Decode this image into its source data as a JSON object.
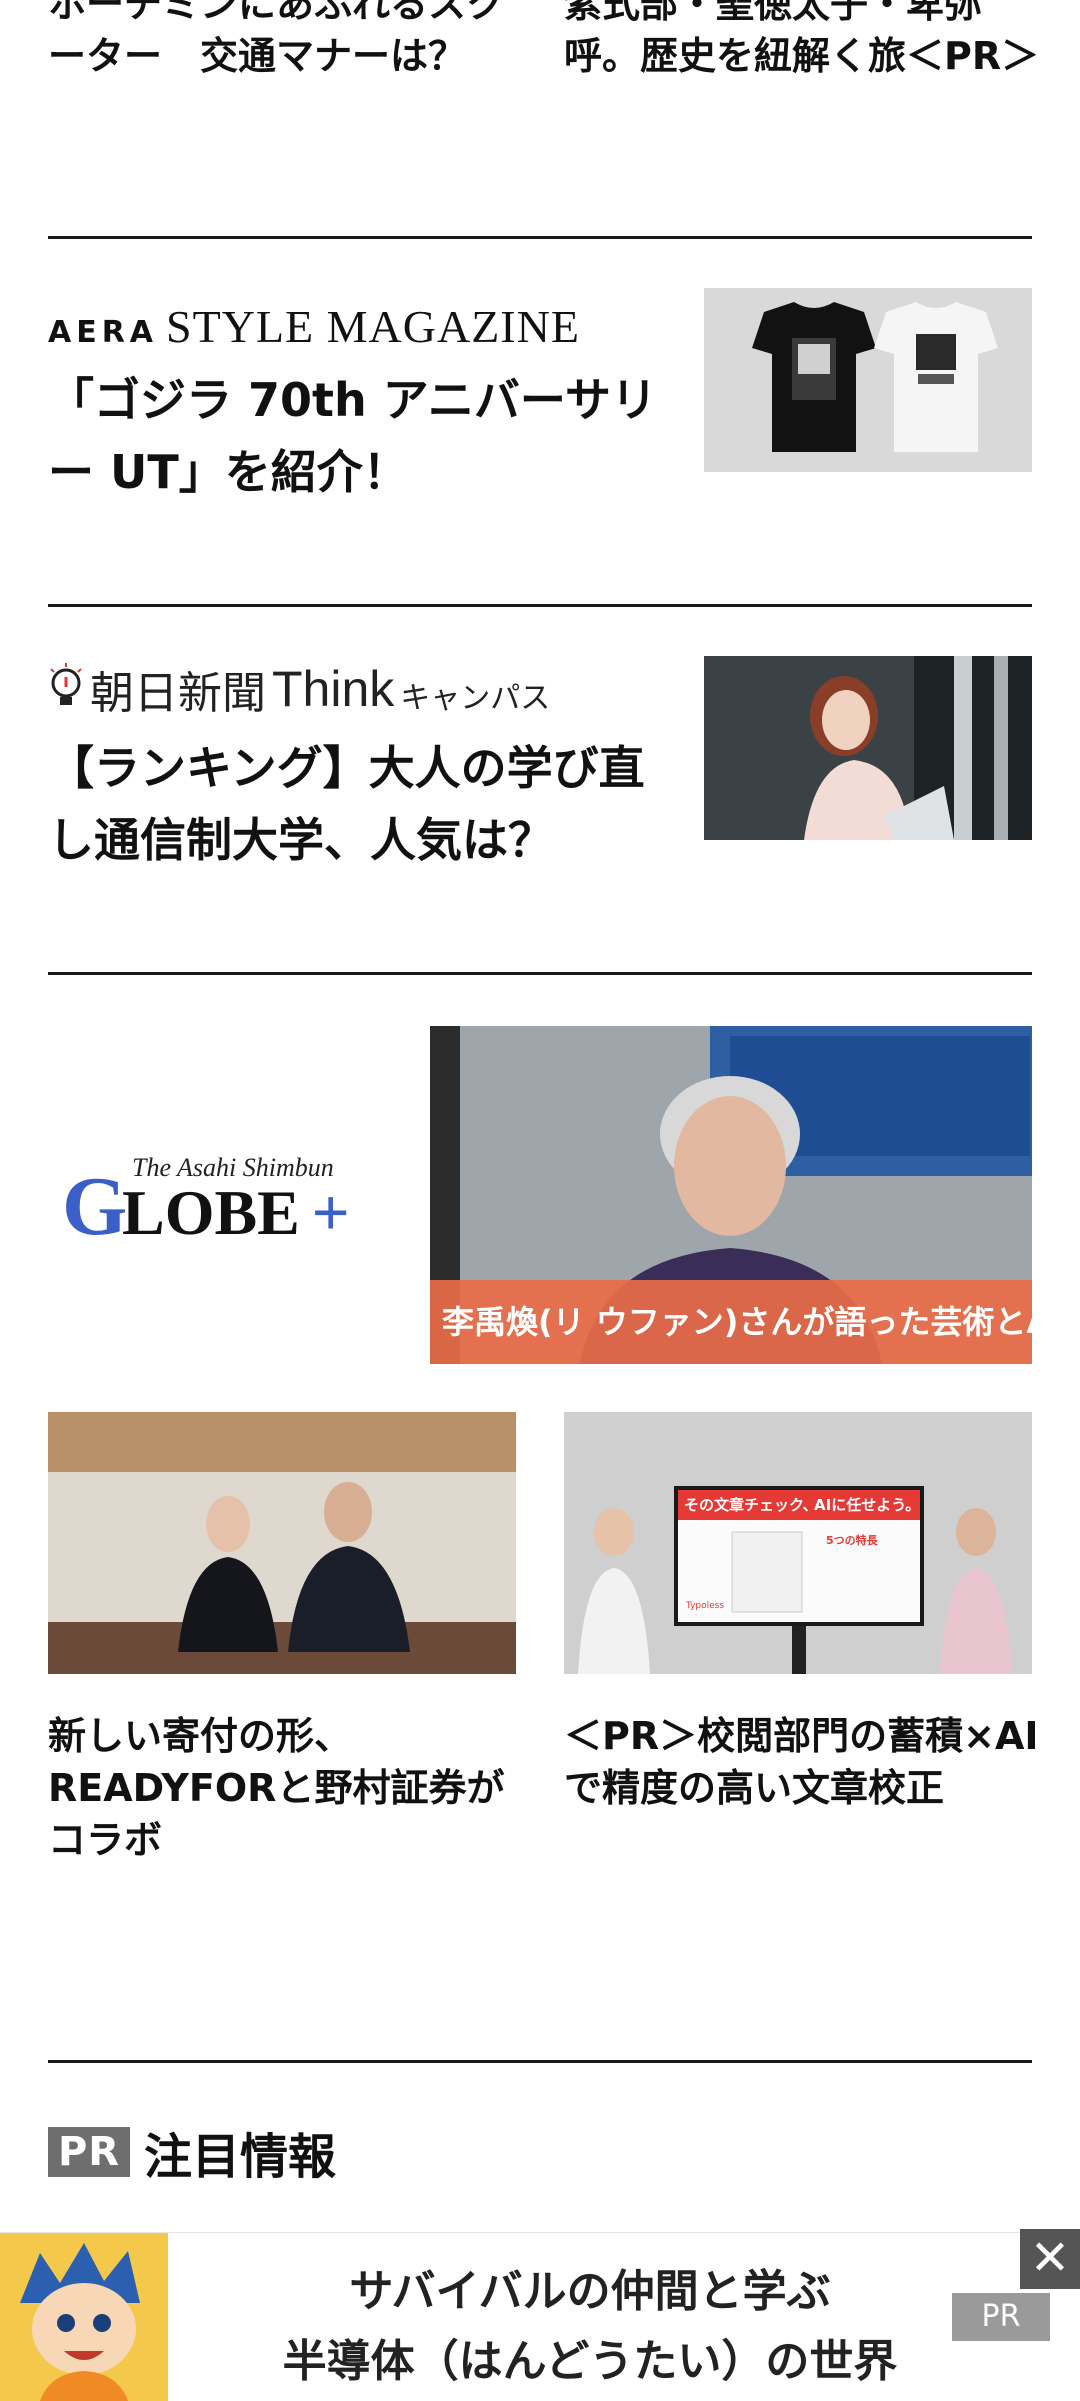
{
  "top": {
    "left_headline": "ホーチミンにあふれるスクーター　交通マナーは？",
    "right_headline": "紫式部・聖徳太子・卑弥呼。歴史を紐解く旅＜PR＞"
  },
  "aera": {
    "brand_aera": "AERA",
    "brand_style": "STYLE MAGAZINE",
    "headline": "「ゴジラ 70th アニバーサリー UT」を紹介！"
  },
  "think": {
    "brand_kanji": "朝日新聞",
    "brand_word": "Think",
    "brand_kana": "キャンパス",
    "headline": "【ランキング】大人の学び直し通信制大学、人気は？"
  },
  "globe": {
    "logo_script": "The Asahi Shimbun",
    "logo_g": "G",
    "logo_rest": "LOBE",
    "logo_plus": "+",
    "caption": "李禹煥(リ ウファン)さんが語った芸術とAI"
  },
  "sub_articles": [
    {
      "headline": "新しい寄付の形、READYFORと野村証券がコラボ"
    },
    {
      "headline": "＜PR＞校閲部門の蓄積×AIで精度の高い文章校正",
      "screen_text_1": "その文章チェック、",
      "screen_text_2": "AIに任せよう。",
      "screen_text_3": "5つの特長",
      "screen_brand": "Typoless"
    }
  ],
  "pr_section": {
    "badge": "PR",
    "title": "注目情報"
  },
  "banner": {
    "line1": "サバイバルの仲間と学ぶ",
    "line2": "半導体（はんどうたい）の世界",
    "pr_label": "PR",
    "close_label": "✕"
  },
  "colors": {
    "rule": "#1a1a1a",
    "globe_caption_bg": "#e86c48",
    "globe_blue": "#3a5fc8",
    "typoless_red": "#e53935"
  }
}
